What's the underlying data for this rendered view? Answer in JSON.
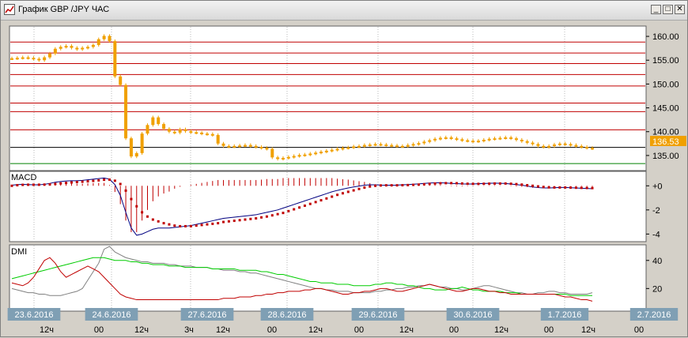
{
  "window": {
    "title": "График GBP /JPY  ЧАС",
    "minimize_glyph": "_",
    "maximize_glyph": "□",
    "close_glyph": "✕"
  },
  "icons": {
    "title": "chart-line-icon"
  },
  "colors": {
    "candle": "#f0a000",
    "resistance": "#c00000",
    "support": "#008000",
    "price_badge_bg": "#f0a000",
    "macd_line": "#000080",
    "macd_signal": "#c00000",
    "dmi_adx": "#808080",
    "dmi_plus": "#00cc00",
    "dmi_minus": "#c00000",
    "date_badge_bg": "#7f9fb4"
  },
  "price_panel": {
    "current_price": "136.53",
    "ylim": [
      132,
      162
    ],
    "ticks": [
      "160.00",
      "155.00",
      "150.00",
      "145.00",
      "140.00",
      "135.00"
    ],
    "tick_values": [
      160,
      155,
      150,
      145,
      140,
      135
    ],
    "resistance_lines": [
      158.8,
      156.5,
      154.3,
      152.0,
      149.6,
      146.0,
      144.2,
      140.4
    ],
    "black_line": 136.7,
    "support_line": 133.3
  },
  "macd_panel": {
    "label": "MACD",
    "ylim": [
      -4.5,
      1.0
    ],
    "ticks": [
      "+0",
      "-2",
      "-4"
    ],
    "tick_values": [
      0,
      -2,
      -4
    ]
  },
  "dmi_panel": {
    "label": "DMI",
    "ylim": [
      5,
      50
    ],
    "ticks": [
      "40",
      "20"
    ],
    "tick_values": [
      40,
      20
    ]
  },
  "time_axis": {
    "date_labels": [
      "23.6.2016",
      "24.6.2016",
      "27.6.2016",
      "28.6.2016",
      "29.6.2016",
      "30.6.2016",
      "1.7.2016",
      "2.7.2016"
    ],
    "hour_labels": [
      "12ч",
      "00",
      "12ч",
      "3ч",
      "12ч",
      "00",
      "12ч",
      "00",
      "12ч",
      "00",
      "12ч",
      "00",
      "12ч",
      "00"
    ]
  },
  "chart_data": {
    "type": "line",
    "series": [
      {
        "values": [
          155.4,
          155.5,
          155.6,
          155.5,
          155.3,
          155.0,
          155.6,
          156.4,
          157.4,
          157.8,
          158.0,
          157.6,
          157.3,
          157.6,
          157.8,
          158.2,
          159.4,
          160.1,
          159.0,
          151.6,
          149.8,
          138.6,
          134.8,
          135.5,
          139.6,
          141.4,
          143.0,
          141.6,
          140.6,
          140.0,
          139.8,
          140.5,
          140.1,
          139.9,
          139.8,
          139.6,
          139.5,
          139.3,
          137.5,
          137.0,
          136.9,
          137.0,
          137.1,
          137.2,
          137.0,
          136.8,
          136.6,
          136.4,
          134.6,
          134.3,
          134.5,
          134.7,
          134.9,
          135.1,
          135.2,
          135.4,
          135.6,
          135.8,
          136.0,
          136.2,
          136.4,
          136.6,
          136.7,
          136.9,
          137.0,
          137.2,
          137.3,
          137.4,
          137.3,
          137.2,
          137.1,
          137.0,
          137.0,
          137.2,
          137.4,
          137.6,
          137.9,
          138.2,
          138.5,
          138.7,
          138.8,
          138.6,
          138.4,
          138.2,
          138.1,
          138.0,
          138.1,
          138.3,
          138.5,
          138.6,
          138.7,
          138.8,
          138.6,
          138.3,
          138.0,
          137.7,
          137.4,
          137.0,
          136.8,
          137.0,
          137.3,
          137.5,
          137.4,
          137.2,
          137.0,
          136.8,
          136.6,
          136.5
        ]
      },
      {
        "values": [
          0.05,
          0.1,
          0.12,
          0.1,
          0.08,
          0.08,
          0.12,
          0.2,
          0.3,
          0.35,
          0.4,
          0.42,
          0.42,
          0.45,
          0.5,
          0.55,
          0.6,
          0.65,
          0.55,
          0.1,
          -0.8,
          -2.2,
          -3.5,
          -4.1,
          -4.0,
          -3.8,
          -3.6,
          -3.5,
          -3.5,
          -3.5,
          -3.45,
          -3.4,
          -3.35,
          -3.3,
          -3.2,
          -3.1,
          -3.0,
          -2.9,
          -2.8,
          -2.7,
          -2.65,
          -2.6,
          -2.55,
          -2.5,
          -2.45,
          -2.4,
          -2.3,
          -2.2,
          -2.1,
          -2.0,
          -1.85,
          -1.7,
          -1.55,
          -1.4,
          -1.25,
          -1.1,
          -0.95,
          -0.8,
          -0.65,
          -0.5,
          -0.38,
          -0.28,
          -0.18,
          -0.1,
          -0.02,
          0.05,
          0.08,
          0.08,
          0.06,
          0.05,
          0.05,
          0.06,
          0.08,
          0.1,
          0.13,
          0.16,
          0.2,
          0.23,
          0.25,
          0.25,
          0.23,
          0.2,
          0.18,
          0.16,
          0.15,
          0.15,
          0.17,
          0.19,
          0.21,
          0.22,
          0.21,
          0.19,
          0.15,
          0.1,
          0.05,
          -0.02,
          -0.1,
          -0.15,
          -0.18,
          -0.18,
          -0.16,
          -0.14,
          -0.14,
          -0.16,
          -0.18,
          -0.2,
          -0.22,
          -0.24
        ]
      },
      {
        "values": [
          0.0,
          0.05,
          0.08,
          0.09,
          0.09,
          0.09,
          0.1,
          0.12,
          0.16,
          0.2,
          0.24,
          0.28,
          0.31,
          0.34,
          0.37,
          0.41,
          0.45,
          0.5,
          0.51,
          0.42,
          0.15,
          -0.4,
          -1.1,
          -1.7,
          -2.2,
          -2.55,
          -2.8,
          -2.95,
          -3.1,
          -3.2,
          -3.3,
          -3.35,
          -3.35,
          -3.35,
          -3.3,
          -3.25,
          -3.2,
          -3.15,
          -3.1,
          -3.0,
          -2.95,
          -2.9,
          -2.85,
          -2.8,
          -2.75,
          -2.7,
          -2.62,
          -2.55,
          -2.45,
          -2.35,
          -2.25,
          -2.1,
          -1.95,
          -1.8,
          -1.65,
          -1.5,
          -1.35,
          -1.2,
          -1.05,
          -0.9,
          -0.75,
          -0.62,
          -0.5,
          -0.38,
          -0.26,
          -0.15,
          -0.06,
          0.0,
          0.03,
          0.04,
          0.04,
          0.04,
          0.05,
          0.06,
          0.08,
          0.1,
          0.13,
          0.16,
          0.19,
          0.21,
          0.22,
          0.22,
          0.21,
          0.19,
          0.17,
          0.16,
          0.16,
          0.17,
          0.18,
          0.19,
          0.19,
          0.19,
          0.17,
          0.14,
          0.1,
          0.05,
          0.0,
          -0.05,
          -0.1,
          -0.13,
          -0.14,
          -0.14,
          -0.14,
          -0.15,
          -0.16,
          -0.17,
          -0.18,
          -0.19
        ]
      },
      {
        "values": [
          20,
          19,
          18,
          17,
          17,
          16,
          16,
          15,
          15,
          15,
          16,
          17,
          18,
          20,
          26,
          32,
          38,
          48,
          50,
          46,
          44,
          42,
          41,
          40,
          39,
          39,
          38,
          38,
          38,
          37,
          37,
          36,
          36,
          36,
          35,
          35,
          35,
          34,
          34,
          33,
          33,
          33,
          32,
          32,
          31,
          31,
          30,
          29,
          28,
          27,
          26,
          25,
          24,
          23,
          22,
          21,
          20,
          20,
          19,
          19,
          18,
          18,
          18,
          17,
          17,
          17,
          17,
          18,
          18,
          19,
          19,
          20,
          20,
          21,
          21,
          22,
          22,
          23,
          22,
          21,
          21,
          20,
          20,
          19,
          19,
          20,
          21,
          22,
          22,
          21,
          20,
          19,
          18,
          17,
          17,
          16,
          16,
          17,
          17,
          18,
          18,
          17,
          17,
          16,
          16,
          16,
          16,
          17
        ]
      },
      {
        "values": [
          27,
          28,
          29,
          30,
          31,
          32,
          33,
          34,
          35,
          36,
          37,
          38,
          39,
          40,
          41,
          42,
          42,
          42,
          41,
          40,
          40,
          40,
          39,
          39,
          38,
          38,
          37,
          37,
          37,
          36,
          36,
          36,
          35,
          35,
          35,
          35,
          35,
          34,
          34,
          34,
          34,
          34,
          33,
          33,
          33,
          33,
          32,
          32,
          31,
          30,
          30,
          29,
          28,
          27,
          26,
          25,
          25,
          24,
          24,
          24,
          23,
          23,
          23,
          22,
          22,
          22,
          22,
          23,
          23,
          24,
          24,
          23,
          23,
          22,
          22,
          21,
          20,
          20,
          19,
          19,
          19,
          20,
          20,
          21,
          20,
          19,
          19,
          18,
          18,
          18,
          18,
          17,
          17,
          17,
          16,
          16,
          16,
          16,
          16,
          16,
          16,
          16,
          16,
          15,
          15,
          15,
          15,
          15
        ]
      },
      {
        "values": [
          24,
          23,
          22,
          24,
          28,
          34,
          40,
          42,
          38,
          32,
          28,
          30,
          32,
          34,
          36,
          34,
          32,
          28,
          24,
          20,
          16,
          14,
          13,
          12,
          12,
          12,
          12,
          12,
          12,
          12,
          12,
          12,
          12,
          12,
          12,
          12,
          12,
          12,
          12,
          13,
          13,
          13,
          14,
          14,
          14,
          15,
          15,
          16,
          16,
          17,
          17,
          18,
          18,
          18,
          19,
          19,
          20,
          20,
          19,
          18,
          17,
          16,
          16,
          17,
          17,
          18,
          18,
          19,
          20,
          20,
          19,
          18,
          18,
          19,
          20,
          21,
          22,
          23,
          22,
          21,
          20,
          19,
          18,
          18,
          19,
          20,
          20,
          19,
          18,
          18,
          17,
          17,
          16,
          16,
          16,
          16,
          16,
          16,
          16,
          16,
          16,
          15,
          14,
          14,
          13,
          12,
          12,
          11
        ]
      }
    ]
  }
}
